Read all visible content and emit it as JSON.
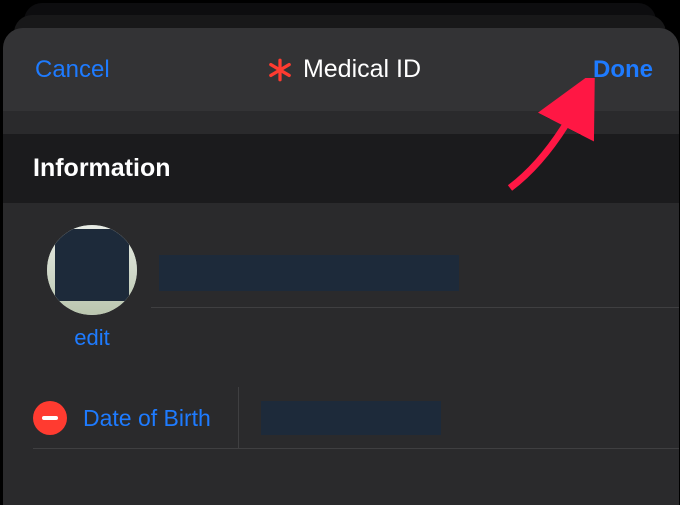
{
  "navbar": {
    "cancel_label": "Cancel",
    "title": "Medical ID",
    "done_label": "Done"
  },
  "section": {
    "header": "Information"
  },
  "profile": {
    "edit_label": "edit",
    "name_value": ""
  },
  "dob": {
    "label": "Date of Birth",
    "value": ""
  }
}
